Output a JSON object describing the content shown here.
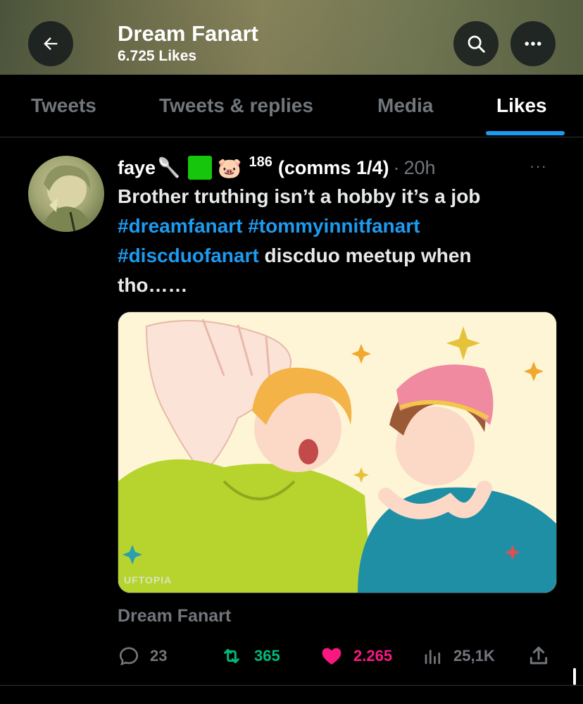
{
  "header": {
    "title": "Dream Fanart",
    "subtitle": "6.725 Likes",
    "back_icon": "arrow-left-icon",
    "search_icon": "search-icon",
    "more_icon": "more-horizontal-icon"
  },
  "tabs": [
    {
      "label": "Tweets",
      "active": false
    },
    {
      "label": "Tweets & replies",
      "active": false
    },
    {
      "label": "Media",
      "active": false
    },
    {
      "label": "Likes",
      "active": true
    }
  ],
  "tweet": {
    "author_name": "faye",
    "author_emojis": [
      "🥄",
      "🟩",
      "🐷"
    ],
    "author_sup": "186",
    "author_suffix": "(comms 1/4)",
    "separator": "·",
    "time": "20h",
    "more": "···",
    "text_line1": "Brother truthing isn’t a hobby it’s a job",
    "hashtag1": "#dreamfanart",
    "hashtag2": "#tommyinnitfanart",
    "hashtag3": "#discduofanart",
    "text_line3_rest": " discduo meetup when",
    "text_line4": "tho……",
    "image_watermark": "UFTOPIA",
    "source": "Dream Fanart",
    "stats": {
      "replies": "23",
      "retweets": "365",
      "likes": "2.265",
      "views": "25,1K"
    }
  },
  "colors": {
    "accent": "#1d9bf0",
    "like": "#f91880",
    "retweet": "#00ba7c",
    "muted": "#71767b"
  }
}
